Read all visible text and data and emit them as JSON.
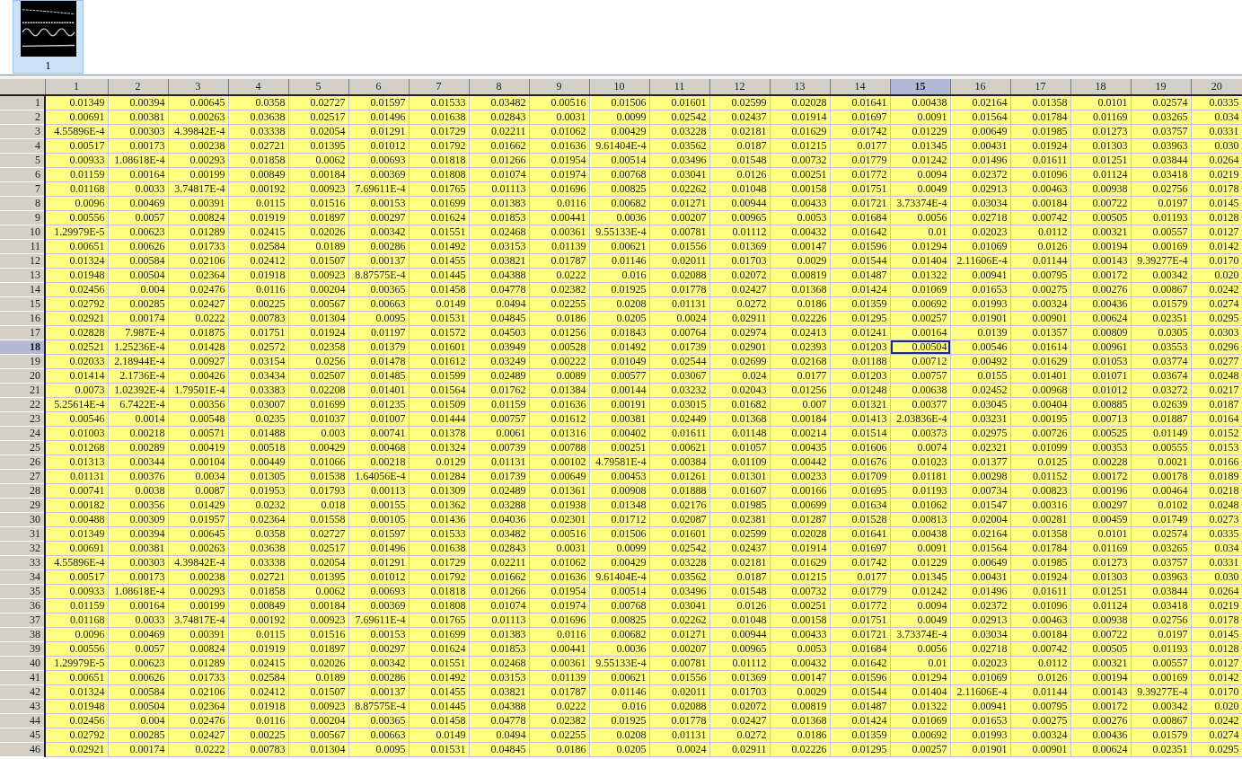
{
  "thumbnails": [
    {
      "label": "1",
      "selected": true
    }
  ],
  "table": {
    "columns": [
      {
        "label": "1",
        "selected": false
      },
      {
        "label": "2",
        "selected": false
      },
      {
        "label": "3",
        "selected": false
      },
      {
        "label": "4",
        "selected": false
      },
      {
        "label": "5",
        "selected": false
      },
      {
        "label": "6",
        "selected": false
      },
      {
        "label": "7",
        "selected": false
      },
      {
        "label": "8",
        "selected": false
      },
      {
        "label": "9",
        "selected": false
      },
      {
        "label": "10",
        "selected": false
      },
      {
        "label": "11",
        "selected": false
      },
      {
        "label": "12",
        "selected": false
      },
      {
        "label": "13",
        "selected": false
      },
      {
        "label": "14",
        "selected": false
      },
      {
        "label": "15",
        "selected": true
      },
      {
        "label": "16",
        "selected": false
      },
      {
        "label": "17",
        "selected": false
      },
      {
        "label": "18",
        "selected": false
      },
      {
        "label": "19",
        "selected": false
      },
      {
        "label": "20",
        "selected": false
      }
    ],
    "rows": [
      {
        "label": "1",
        "selected": false,
        "cells": [
          "0.01349",
          "0.00394",
          "0.00645",
          "0.0358",
          "0.02727",
          "0.01597",
          "0.01533",
          "0.03482",
          "0.00516",
          "0.01506",
          "0.01601",
          "0.02599",
          "0.02028",
          "0.01641",
          "0.00438",
          "0.02164",
          "0.01358",
          "0.0101",
          "0.02574",
          "0.0335"
        ]
      },
      {
        "label": "2",
        "selected": false,
        "cells": [
          "0.00691",
          "0.00381",
          "0.00263",
          "0.03638",
          "0.02517",
          "0.01496",
          "0.01638",
          "0.02843",
          "0.0031",
          "0.0099",
          "0.02542",
          "0.02437",
          "0.01914",
          "0.01697",
          "0.0091",
          "0.01564",
          "0.01784",
          "0.01169",
          "0.03265",
          "0.034"
        ]
      },
      {
        "label": "3",
        "selected": false,
        "cells": [
          "4.55896E-4",
          "0.00303",
          "4.39842E-4",
          "0.03338",
          "0.02054",
          "0.01291",
          "0.01729",
          "0.02211",
          "0.01062",
          "0.00429",
          "0.03228",
          "0.02181",
          "0.01629",
          "0.01742",
          "0.01229",
          "0.00649",
          "0.01985",
          "0.01273",
          "0.03757",
          "0.0331"
        ]
      },
      {
        "label": "4",
        "selected": false,
        "cells": [
          "0.00517",
          "0.00173",
          "0.00238",
          "0.02721",
          "0.01395",
          "0.01012",
          "0.01792",
          "0.01662",
          "0.01636",
          "9.61404E-4",
          "0.03562",
          "0.0187",
          "0.01215",
          "0.0177",
          "0.01345",
          "0.00431",
          "0.01924",
          "0.01303",
          "0.03963",
          "0.030"
        ]
      },
      {
        "label": "5",
        "selected": false,
        "cells": [
          "0.00933",
          "1.08618E-4",
          "0.00293",
          "0.01858",
          "0.0062",
          "0.00693",
          "0.01818",
          "0.01266",
          "0.01954",
          "0.00514",
          "0.03496",
          "0.01548",
          "0.00732",
          "0.01779",
          "0.01242",
          "0.01496",
          "0.01611",
          "0.01251",
          "0.03844",
          "0.0264"
        ]
      },
      {
        "label": "6",
        "selected": false,
        "cells": [
          "0.01159",
          "0.00164",
          "0.00199",
          "0.00849",
          "0.00184",
          "0.00369",
          "0.01808",
          "0.01074",
          "0.01974",
          "0.00768",
          "0.03041",
          "0.0126",
          "0.00251",
          "0.01772",
          "0.0094",
          "0.02372",
          "0.01096",
          "0.01124",
          "0.03418",
          "0.0219"
        ]
      },
      {
        "label": "7",
        "selected": false,
        "cells": [
          "0.01168",
          "0.0033",
          "3.74817E-4",
          "0.00192",
          "0.00923",
          "7.69611E-4",
          "0.01765",
          "0.01113",
          "0.01696",
          "0.00825",
          "0.02262",
          "0.01048",
          "0.00158",
          "0.01751",
          "0.0049",
          "0.02913",
          "0.00463",
          "0.00938",
          "0.02756",
          "0.0178"
        ]
      },
      {
        "label": "8",
        "selected": false,
        "cells": [
          "0.0096",
          "0.00469",
          "0.00391",
          "0.0115",
          "0.01516",
          "0.00153",
          "0.01699",
          "0.01383",
          "0.0116",
          "0.00682",
          "0.01271",
          "0.00944",
          "0.00433",
          "0.01721",
          "3.73374E-4",
          "0.03034",
          "0.00184",
          "0.00722",
          "0.0197",
          "0.0145"
        ]
      },
      {
        "label": "9",
        "selected": false,
        "cells": [
          "0.00556",
          "0.0057",
          "0.00824",
          "0.01919",
          "0.01897",
          "0.00297",
          "0.01624",
          "0.01853",
          "0.00441",
          "0.0036",
          "0.00207",
          "0.00965",
          "0.0053",
          "0.01684",
          "0.0056",
          "0.02718",
          "0.00742",
          "0.00505",
          "0.01193",
          "0.0128"
        ]
      },
      {
        "label": "10",
        "selected": false,
        "cells": [
          "1.29979E-5",
          "0.00623",
          "0.01289",
          "0.02415",
          "0.02026",
          "0.00342",
          "0.01551",
          "0.02468",
          "0.00361",
          "9.55133E-4",
          "0.00781",
          "0.01112",
          "0.00432",
          "0.01642",
          "0.01",
          "0.02023",
          "0.0112",
          "0.00321",
          "0.00557",
          "0.0127"
        ]
      },
      {
        "label": "11",
        "selected": false,
        "cells": [
          "0.00651",
          "0.00626",
          "0.01733",
          "0.02584",
          "0.0189",
          "0.00286",
          "0.01492",
          "0.03153",
          "0.01139",
          "0.00621",
          "0.01556",
          "0.01369",
          "0.00147",
          "0.01596",
          "0.01294",
          "0.01069",
          "0.0126",
          "0.00194",
          "0.00169",
          "0.0142"
        ]
      },
      {
        "label": "12",
        "selected": false,
        "cells": [
          "0.01324",
          "0.00584",
          "0.02106",
          "0.02412",
          "0.01507",
          "0.00137",
          "0.01455",
          "0.03821",
          "0.01787",
          "0.01146",
          "0.02011",
          "0.01703",
          "0.0029",
          "0.01544",
          "0.01404",
          "2.11606E-4",
          "0.01144",
          "0.00143",
          "9.39277E-4",
          "0.0170"
        ]
      },
      {
        "label": "13",
        "selected": false,
        "cells": [
          "0.01948",
          "0.00504",
          "0.02364",
          "0.01918",
          "0.00923",
          "8.87575E-4",
          "0.01445",
          "0.04388",
          "0.0222",
          "0.016",
          "0.02088",
          "0.02072",
          "0.00819",
          "0.01487",
          "0.01322",
          "0.00941",
          "0.00795",
          "0.00172",
          "0.00342",
          "0.020"
        ]
      },
      {
        "label": "14",
        "selected": false,
        "cells": [
          "0.02456",
          "0.004",
          "0.02476",
          "0.0116",
          "0.00204",
          "0.00365",
          "0.01458",
          "0.04778",
          "0.02382",
          "0.01925",
          "0.01778",
          "0.02427",
          "0.01368",
          "0.01424",
          "0.01069",
          "0.01653",
          "0.00275",
          "0.00276",
          "0.00867",
          "0.0242"
        ]
      },
      {
        "label": "15",
        "selected": false,
        "cells": [
          "0.02792",
          "0.00285",
          "0.02427",
          "0.00225",
          "0.00567",
          "0.00663",
          "0.0149",
          "0.0494",
          "0.02255",
          "0.0208",
          "0.01131",
          "0.0272",
          "0.0186",
          "0.01359",
          "0.00692",
          "0.01993",
          "0.00324",
          "0.00436",
          "0.01579",
          "0.0274"
        ]
      },
      {
        "label": "16",
        "selected": false,
        "cells": [
          "0.02921",
          "0.00174",
          "0.0222",
          "0.00783",
          "0.01304",
          "0.0095",
          "0.01531",
          "0.04845",
          "0.0186",
          "0.0205",
          "0.0024",
          "0.02911",
          "0.02226",
          "0.01295",
          "0.00257",
          "0.01901",
          "0.00901",
          "0.00624",
          "0.02351",
          "0.0295"
        ]
      },
      {
        "label": "17",
        "selected": false,
        "cells": [
          "0.02828",
          "7.987E-4",
          "0.01875",
          "0.01751",
          "0.01924",
          "0.01197",
          "0.01572",
          "0.04503",
          "0.01256",
          "0.01843",
          "0.00764",
          "0.02974",
          "0.02413",
          "0.01241",
          "0.00164",
          "0.0139",
          "0.01357",
          "0.00809",
          "0.0305",
          "0.0303"
        ]
      },
      {
        "label": "18",
        "selected": true,
        "cells": [
          "0.02521",
          "1.25236E-4",
          "0.01428",
          "0.02572",
          "0.02358",
          "0.01379",
          "0.01601",
          "0.03949",
          "0.00528",
          "0.01492",
          "0.01739",
          "0.02901",
          "0.02393",
          "0.01203",
          "0.00504",
          "0.00546",
          "0.01614",
          "0.00961",
          "0.03553",
          "0.0296"
        ]
      },
      {
        "label": "19",
        "selected": false,
        "cells": [
          "0.02033",
          "2.18944E-4",
          "0.00927",
          "0.03154",
          "0.0256",
          "0.01478",
          "0.01612",
          "0.03249",
          "0.00222",
          "0.01049",
          "0.02544",
          "0.02699",
          "0.02168",
          "0.01188",
          "0.00712",
          "0.00492",
          "0.01629",
          "0.01053",
          "0.03774",
          "0.0277"
        ]
      },
      {
        "label": "20",
        "selected": false,
        "cells": [
          "0.01414",
          "2.1736E-4",
          "0.00426",
          "0.03434",
          "0.02507",
          "0.01485",
          "0.01599",
          "0.02489",
          "0.0089",
          "0.00577",
          "0.03067",
          "0.024",
          "0.0177",
          "0.01203",
          "0.00757",
          "0.0155",
          "0.01401",
          "0.01071",
          "0.03674",
          "0.0248"
        ]
      },
      {
        "label": "21",
        "selected": false,
        "cells": [
          "0.0073",
          "1.02392E-4",
          "1.79501E-4",
          "0.03383",
          "0.02208",
          "0.01401",
          "0.01564",
          "0.01762",
          "0.01384",
          "0.00144",
          "0.03232",
          "0.02043",
          "0.01256",
          "0.01248",
          "0.00638",
          "0.02452",
          "0.00968",
          "0.01012",
          "0.03272",
          "0.0217"
        ]
      },
      {
        "label": "22",
        "selected": false,
        "cells": [
          "5.25614E-4",
          "6.7422E-4",
          "0.00356",
          "0.03007",
          "0.01699",
          "0.01235",
          "0.01509",
          "0.01159",
          "0.01636",
          "0.00191",
          "0.03015",
          "0.01682",
          "0.007",
          "0.01321",
          "0.00377",
          "0.03045",
          "0.00404",
          "0.00885",
          "0.02639",
          "0.0187"
        ]
      },
      {
        "label": "23",
        "selected": false,
        "cells": [
          "0.00546",
          "0.0014",
          "0.00548",
          "0.0235",
          "0.01037",
          "0.01007",
          "0.01444",
          "0.00757",
          "0.01612",
          "0.00381",
          "0.02449",
          "0.01368",
          "0.00184",
          "0.01413",
          "2.03836E-4",
          "0.03231",
          "0.00195",
          "0.00713",
          "0.01887",
          "0.0164"
        ]
      },
      {
        "label": "24",
        "selected": false,
        "cells": [
          "0.01003",
          "0.00218",
          "0.00571",
          "0.01488",
          "0.003",
          "0.00741",
          "0.01378",
          "0.0061",
          "0.01316",
          "0.00402",
          "0.01611",
          "0.01148",
          "0.00214",
          "0.01514",
          "0.00373",
          "0.02975",
          "0.00726",
          "0.00525",
          "0.01149",
          "0.0152"
        ]
      },
      {
        "label": "25",
        "selected": false,
        "cells": [
          "0.01268",
          "0.00289",
          "0.00419",
          "0.00518",
          "0.00429",
          "0.00468",
          "0.01324",
          "0.00739",
          "0.00788",
          "0.00251",
          "0.00621",
          "0.01057",
          "0.00435",
          "0.01606",
          "0.0074",
          "0.02321",
          "0.01099",
          "0.00353",
          "0.00555",
          "0.0153"
        ]
      },
      {
        "label": "26",
        "selected": false,
        "cells": [
          "0.01313",
          "0.00344",
          "0.00104",
          "0.00449",
          "0.01066",
          "0.00218",
          "0.0129",
          "0.01131",
          "0.00102",
          "4.79581E-4",
          "0.00384",
          "0.01109",
          "0.00442",
          "0.01676",
          "0.01023",
          "0.01377",
          "0.0125",
          "0.00228",
          "0.0021",
          "0.0166"
        ]
      },
      {
        "label": "27",
        "selected": false,
        "cells": [
          "0.01131",
          "0.00376",
          "0.0034",
          "0.01305",
          "0.01538",
          "1.64056E-4",
          "0.01284",
          "0.01739",
          "0.00649",
          "0.00453",
          "0.01261",
          "0.01301",
          "0.00233",
          "0.01709",
          "0.01181",
          "0.00298",
          "0.01152",
          "0.00172",
          "0.00178",
          "0.0189"
        ]
      },
      {
        "label": "28",
        "selected": false,
        "cells": [
          "0.00741",
          "0.0038",
          "0.0087",
          "0.01953",
          "0.01793",
          "0.00113",
          "0.01309",
          "0.02489",
          "0.01361",
          "0.00908",
          "0.01888",
          "0.01607",
          "0.00166",
          "0.01695",
          "0.01193",
          "0.00734",
          "0.00823",
          "0.00196",
          "0.00464",
          "0.0218"
        ]
      },
      {
        "label": "29",
        "selected": false,
        "cells": [
          "0.00182",
          "0.00356",
          "0.01429",
          "0.0232",
          "0.018",
          "0.00155",
          "0.01362",
          "0.03288",
          "0.01938",
          "0.01348",
          "0.02176",
          "0.01985",
          "0.00699",
          "0.01634",
          "0.01062",
          "0.01547",
          "0.00316",
          "0.00297",
          "0.0102",
          "0.0248"
        ]
      },
      {
        "label": "30",
        "selected": false,
        "cells": [
          "0.00488",
          "0.00309",
          "0.01957",
          "0.02364",
          "0.01558",
          "0.00105",
          "0.01436",
          "0.04036",
          "0.02301",
          "0.01712",
          "0.02087",
          "0.02381",
          "0.01287",
          "0.01528",
          "0.00813",
          "0.02004",
          "0.00281",
          "0.00459",
          "0.01749",
          "0.0273"
        ]
      },
      {
        "label": "31",
        "selected": false,
        "cells": [
          "0.01349",
          "0.00394",
          "0.00645",
          "0.0358",
          "0.02727",
          "0.01597",
          "0.01533",
          "0.03482",
          "0.00516",
          "0.01506",
          "0.01601",
          "0.02599",
          "0.02028",
          "0.01641",
          "0.00438",
          "0.02164",
          "0.01358",
          "0.0101",
          "0.02574",
          "0.0335"
        ]
      },
      {
        "label": "32",
        "selected": false,
        "cells": [
          "0.00691",
          "0.00381",
          "0.00263",
          "0.03638",
          "0.02517",
          "0.01496",
          "0.01638",
          "0.02843",
          "0.0031",
          "0.0099",
          "0.02542",
          "0.02437",
          "0.01914",
          "0.01697",
          "0.0091",
          "0.01564",
          "0.01784",
          "0.01169",
          "0.03265",
          "0.034"
        ]
      },
      {
        "label": "33",
        "selected": false,
        "cells": [
          "4.55896E-4",
          "0.00303",
          "4.39842E-4",
          "0.03338",
          "0.02054",
          "0.01291",
          "0.01729",
          "0.02211",
          "0.01062",
          "0.00429",
          "0.03228",
          "0.02181",
          "0.01629",
          "0.01742",
          "0.01229",
          "0.00649",
          "0.01985",
          "0.01273",
          "0.03757",
          "0.0331"
        ]
      },
      {
        "label": "34",
        "selected": false,
        "cells": [
          "0.00517",
          "0.00173",
          "0.00238",
          "0.02721",
          "0.01395",
          "0.01012",
          "0.01792",
          "0.01662",
          "0.01636",
          "9.61404E-4",
          "0.03562",
          "0.0187",
          "0.01215",
          "0.0177",
          "0.01345",
          "0.00431",
          "0.01924",
          "0.01303",
          "0.03963",
          "0.030"
        ]
      },
      {
        "label": "35",
        "selected": false,
        "cells": [
          "0.00933",
          "1.08618E-4",
          "0.00293",
          "0.01858",
          "0.0062",
          "0.00693",
          "0.01818",
          "0.01266",
          "0.01954",
          "0.00514",
          "0.03496",
          "0.01548",
          "0.00732",
          "0.01779",
          "0.01242",
          "0.01496",
          "0.01611",
          "0.01251",
          "0.03844",
          "0.0264"
        ]
      },
      {
        "label": "36",
        "selected": false,
        "cells": [
          "0.01159",
          "0.00164",
          "0.00199",
          "0.00849",
          "0.00184",
          "0.00369",
          "0.01808",
          "0.01074",
          "0.01974",
          "0.00768",
          "0.03041",
          "0.0126",
          "0.00251",
          "0.01772",
          "0.0094",
          "0.02372",
          "0.01096",
          "0.01124",
          "0.03418",
          "0.0219"
        ]
      },
      {
        "label": "37",
        "selected": false,
        "cells": [
          "0.01168",
          "0.0033",
          "3.74817E-4",
          "0.00192",
          "0.00923",
          "7.69611E-4",
          "0.01765",
          "0.01113",
          "0.01696",
          "0.00825",
          "0.02262",
          "0.01048",
          "0.00158",
          "0.01751",
          "0.0049",
          "0.02913",
          "0.00463",
          "0.00938",
          "0.02756",
          "0.0178"
        ]
      },
      {
        "label": "38",
        "selected": false,
        "cells": [
          "0.0096",
          "0.00469",
          "0.00391",
          "0.0115",
          "0.01516",
          "0.00153",
          "0.01699",
          "0.01383",
          "0.0116",
          "0.00682",
          "0.01271",
          "0.00944",
          "0.00433",
          "0.01721",
          "3.73374E-4",
          "0.03034",
          "0.00184",
          "0.00722",
          "0.0197",
          "0.0145"
        ]
      },
      {
        "label": "39",
        "selected": false,
        "cells": [
          "0.00556",
          "0.0057",
          "0.00824",
          "0.01919",
          "0.01897",
          "0.00297",
          "0.01624",
          "0.01853",
          "0.00441",
          "0.0036",
          "0.00207",
          "0.00965",
          "0.0053",
          "0.01684",
          "0.0056",
          "0.02718",
          "0.00742",
          "0.00505",
          "0.01193",
          "0.0128"
        ]
      },
      {
        "label": "40",
        "selected": false,
        "cells": [
          "1.29979E-5",
          "0.00623",
          "0.01289",
          "0.02415",
          "0.02026",
          "0.00342",
          "0.01551",
          "0.02468",
          "0.00361",
          "9.55133E-4",
          "0.00781",
          "0.01112",
          "0.00432",
          "0.01642",
          "0.01",
          "0.02023",
          "0.0112",
          "0.00321",
          "0.00557",
          "0.0127"
        ]
      },
      {
        "label": "41",
        "selected": false,
        "cells": [
          "0.00651",
          "0.00626",
          "0.01733",
          "0.02584",
          "0.0189",
          "0.00286",
          "0.01492",
          "0.03153",
          "0.01139",
          "0.00621",
          "0.01556",
          "0.01369",
          "0.00147",
          "0.01596",
          "0.01294",
          "0.01069",
          "0.0126",
          "0.00194",
          "0.00169",
          "0.0142"
        ]
      },
      {
        "label": "42",
        "selected": false,
        "cells": [
          "0.01324",
          "0.00584",
          "0.02106",
          "0.02412",
          "0.01507",
          "0.00137",
          "0.01455",
          "0.03821",
          "0.01787",
          "0.01146",
          "0.02011",
          "0.01703",
          "0.0029",
          "0.01544",
          "0.01404",
          "2.11606E-4",
          "0.01144",
          "0.00143",
          "9.39277E-4",
          "0.0170"
        ]
      },
      {
        "label": "43",
        "selected": false,
        "cells": [
          "0.01948",
          "0.00504",
          "0.02364",
          "0.01918",
          "0.00923",
          "8.87575E-4",
          "0.01445",
          "0.04388",
          "0.0222",
          "0.016",
          "0.02088",
          "0.02072",
          "0.00819",
          "0.01487",
          "0.01322",
          "0.00941",
          "0.00795",
          "0.00172",
          "0.00342",
          "0.020"
        ]
      },
      {
        "label": "44",
        "selected": false,
        "cells": [
          "0.02456",
          "0.004",
          "0.02476",
          "0.0116",
          "0.00204",
          "0.00365",
          "0.01458",
          "0.04778",
          "0.02382",
          "0.01925",
          "0.01778",
          "0.02427",
          "0.01368",
          "0.01424",
          "0.01069",
          "0.01653",
          "0.00275",
          "0.00276",
          "0.00867",
          "0.0242"
        ]
      },
      {
        "label": "45",
        "selected": false,
        "cells": [
          "0.02792",
          "0.00285",
          "0.02427",
          "0.00225",
          "0.00567",
          "0.00663",
          "0.0149",
          "0.0494",
          "0.02255",
          "0.0208",
          "0.01131",
          "0.0272",
          "0.0186",
          "0.01359",
          "0.00692",
          "0.01993",
          "0.00324",
          "0.00436",
          "0.01579",
          "0.0274"
        ]
      },
      {
        "label": "46",
        "selected": false,
        "cells": [
          "0.02921",
          "0.00174",
          "0.0222",
          "0.00783",
          "0.01304",
          "0.0095",
          "0.01531",
          "0.04845",
          "0.0186",
          "0.0205",
          "0.0024",
          "0.02911",
          "0.02226",
          "0.01295",
          "0.00257",
          "0.01901",
          "0.00901",
          "0.00624",
          "0.02351",
          "0.0295"
        ]
      }
    ]
  }
}
